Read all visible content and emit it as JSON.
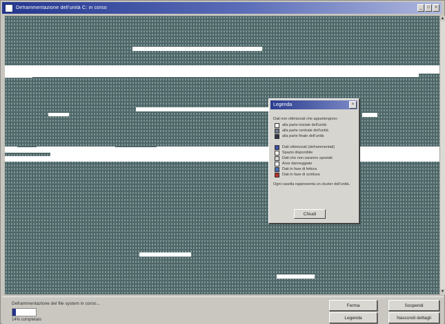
{
  "window": {
    "title": "Deframmentazione dell'unità C: in corso",
    "buttons": [
      "_",
      "□",
      "×"
    ]
  },
  "legend": {
    "title": "Legenda",
    "close_label": "×",
    "intro": "Dati non ottimizzati che appartengono:",
    "items_top": [
      {
        "label": "alla parte iniziale dell'unità",
        "color": "#ffffff"
      },
      {
        "label": "alla parte centrale dell'unità",
        "color": "#6f7c8a"
      },
      {
        "label": "alla parte finale dell'unità",
        "color": "#2f3540"
      }
    ],
    "items_bottom": [
      {
        "label": "Dati ottimizzati (deframmentati)",
        "color": "#3b4fa5"
      },
      {
        "label": "Spazio disponibile",
        "color": "#ffffff"
      },
      {
        "label": "Dati che non saranno spostati",
        "color": "#d7d5cf"
      },
      {
        "label": "Aree danneggiate",
        "color": "#ffffff"
      },
      {
        "label": "Dati in fase di lettura",
        "color": "#4a6fb0"
      },
      {
        "label": "Dati in fase di scrittura",
        "color": "#b8322c"
      }
    ],
    "note": "Ogni casella rappresenta un cluster dell'unità.",
    "close_button": "Chiudi"
  },
  "status": {
    "text": "Deframmentazione del file system in corso...",
    "percent_text": "14% completato",
    "progress": 0.14
  },
  "buttons": {
    "stop": "Ferma",
    "pause": "Sospendi",
    "legend": "Legenda",
    "hide_details": "Nascondi dettagli"
  },
  "colors": {
    "map_bg": "#4f6668",
    "cluster_light": "#7c9393",
    "free_space": "#ffffff",
    "title_blue": "#24378e"
  }
}
